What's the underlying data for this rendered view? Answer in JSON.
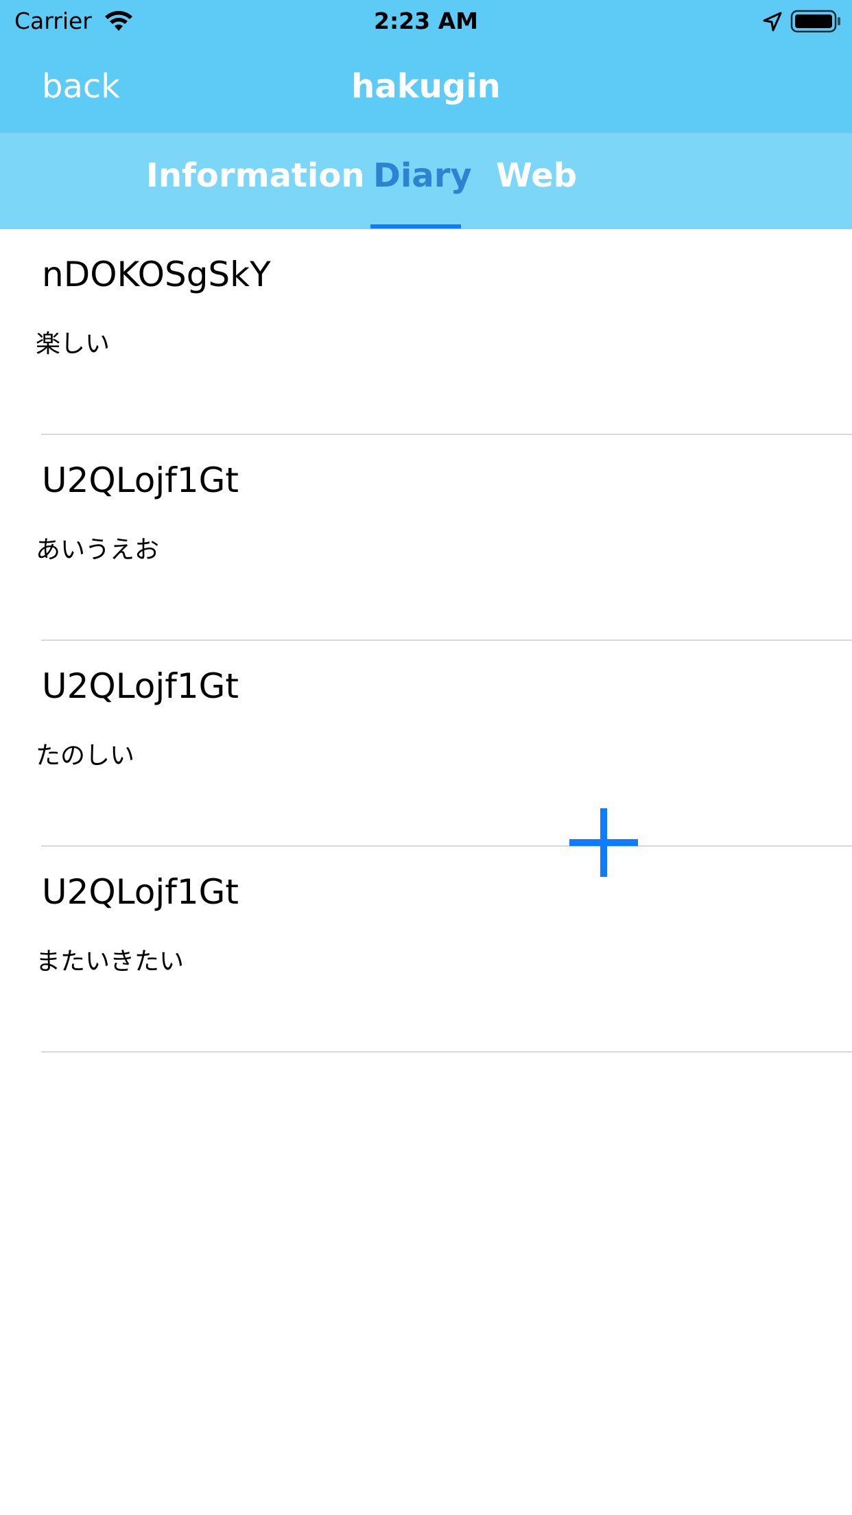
{
  "status_bar": {
    "carrier": "Carrier",
    "time": "2:23 AM",
    "icons": [
      "wifi-icon",
      "location-arrow-icon",
      "battery-icon"
    ]
  },
  "nav": {
    "back_label": "back",
    "title": "hakugin"
  },
  "tabs": [
    {
      "label": "Information",
      "active": false
    },
    {
      "label": "Diary",
      "active": true
    },
    {
      "label": "Web",
      "active": false
    }
  ],
  "diary_entries": [
    {
      "user": "nDOKOSgSkY",
      "text": "楽しい"
    },
    {
      "user": "U2QLojf1Gt",
      "text": "あいうえお"
    },
    {
      "user": "U2QLojf1Gt",
      "text": "たのしい"
    },
    {
      "user": "U2QLojf1Gt",
      "text": "またいきたい"
    }
  ],
  "add_button": {
    "icon": "plus-icon"
  },
  "colors": {
    "nav_background": "#5ecbf7",
    "tab_background": "#7cd6f8",
    "active_tab_text": "#2e83d0",
    "tab_indicator": "#0f7bff",
    "add_button": "#0f7bff"
  }
}
